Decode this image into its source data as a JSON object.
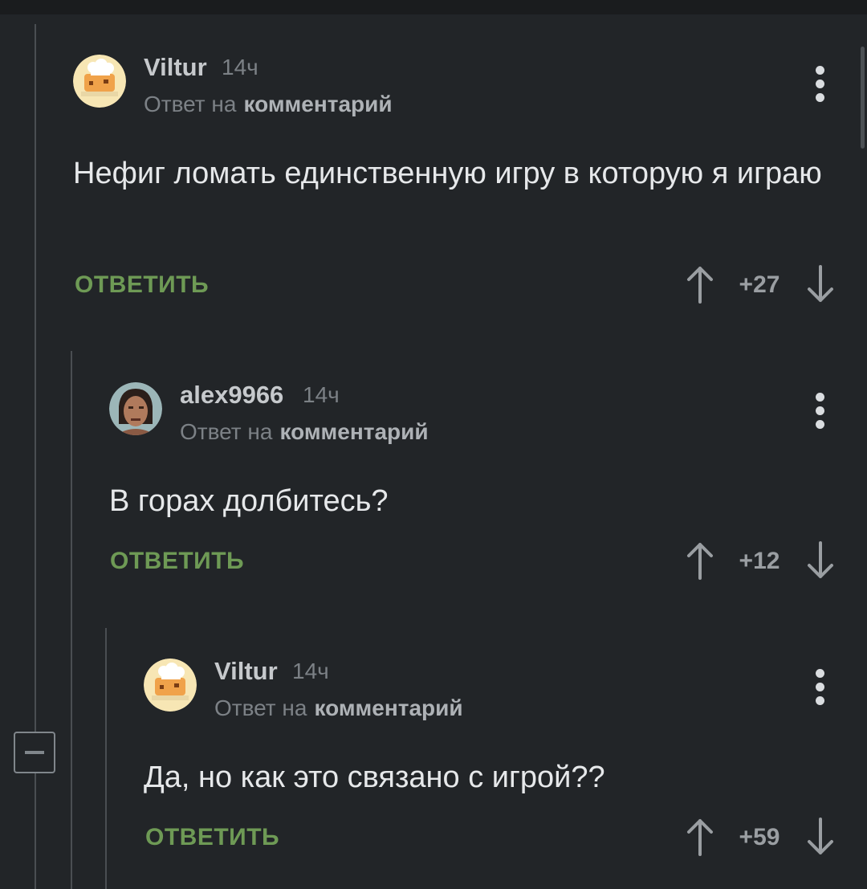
{
  "comments": [
    {
      "author": "Viltur",
      "time": "14ч",
      "reply_prefix": "Ответ на",
      "reply_target": "комментарий",
      "text": "Нефиг ломать единственную игру в которую я играю",
      "reply_label": "ОТВЕТИТЬ",
      "score": "+27"
    },
    {
      "author": "alex9966",
      "time": "14ч",
      "reply_prefix": "Ответ на",
      "reply_target": "комментарий",
      "text": "В горах долбитесь?",
      "reply_label": "ОТВЕТИТЬ",
      "score": "+12"
    },
    {
      "author": "Viltur",
      "time": "14ч",
      "reply_prefix": "Ответ на",
      "reply_target": "комментарий",
      "text": "Да, но как это связано с игрой??",
      "reply_label": "ОТВЕТИТЬ",
      "score": "+59"
    }
  ],
  "colors": {
    "background": "#222528",
    "reply_button": "#6e9a55",
    "muted_text": "#7c8186",
    "thread_line": "#4a4e52"
  },
  "icons": {
    "vote_up": "arrow-up-icon",
    "vote_down": "arrow-down-icon",
    "menu": "more-vertical-icon",
    "collapse": "minus-square-icon"
  }
}
